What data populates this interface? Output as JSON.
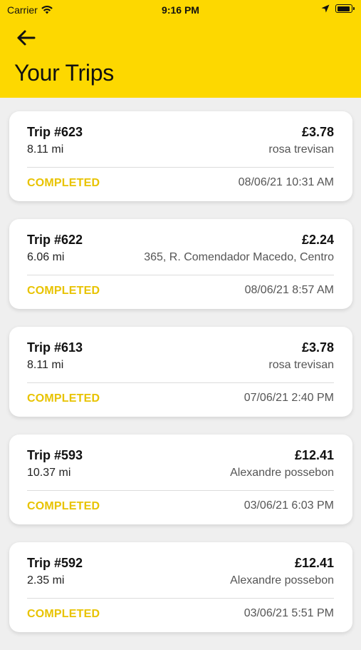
{
  "status_bar": {
    "carrier": "Carrier",
    "time": "9:16 PM"
  },
  "header": {
    "title": "Your Trips",
    "background_color": "#fdd800"
  },
  "trips": [
    {
      "title": "Trip #623",
      "distance": "8.11 mi",
      "price": "£3.78",
      "place": "rosa trevisan",
      "status": "COMPLETED",
      "date": "08/06/21 10:31 AM"
    },
    {
      "title": "Trip #622",
      "distance": "6.06 mi",
      "price": "£2.24",
      "place": "365, R. Comendador Macedo, Centro",
      "status": "COMPLETED",
      "date": "08/06/21 8:57 AM"
    },
    {
      "title": "Trip #613",
      "distance": "8.11 mi",
      "price": "£3.78",
      "place": "rosa trevisan",
      "status": "COMPLETED",
      "date": "07/06/21 2:40 PM"
    },
    {
      "title": "Trip #593",
      "distance": "10.37 mi",
      "price": "£12.41",
      "place": "Alexandre possebon",
      "status": "COMPLETED",
      "date": "03/06/21 6:03 PM"
    },
    {
      "title": "Trip #592",
      "distance": "2.35 mi",
      "price": "£12.41",
      "place": "Alexandre possebon",
      "status": "COMPLETED",
      "date": "03/06/21 5:51 PM"
    }
  ],
  "icons": {
    "back": "arrow-left-icon",
    "wifi": "wifi-icon",
    "location": "location-arrow-icon",
    "battery": "battery-icon"
  },
  "colors": {
    "accent": "#fdd800",
    "status_completed": "#e8c300"
  }
}
